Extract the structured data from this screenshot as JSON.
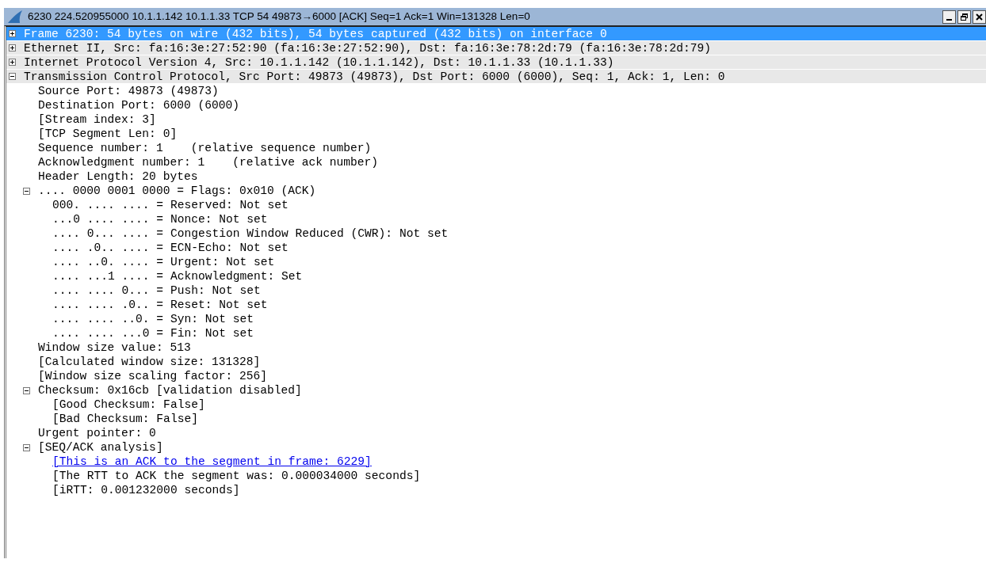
{
  "window": {
    "title": "6230 224.520955000 10.1.1.142 10.1.1.33 TCP 54 49873→6000 [ACK] Seq=1 Ack=1 Win=131328 Len=0"
  },
  "tree": [
    {
      "text": "Frame 6230: 54 bytes on wire (432 bits), 54 bytes captured (432 bits) on interface 0",
      "expanded": false,
      "selected": true
    },
    {
      "text": "Ethernet II, Src: fa:16:3e:27:52:90 (fa:16:3e:27:52:90), Dst: fa:16:3e:78:2d:79 (fa:16:3e:78:2d:79)",
      "expanded": false,
      "selected": false
    },
    {
      "text": "Internet Protocol Version 4, Src: 10.1.1.142 (10.1.1.142), Dst: 10.1.1.33 (10.1.1.33)",
      "expanded": false,
      "selected": false
    },
    {
      "text": "Transmission Control Protocol, Src Port: 49873 (49873), Dst Port: 6000 (6000), Seq: 1, Ack: 1, Len: 0",
      "expanded": true,
      "selected": false,
      "children": [
        {
          "text": "Source Port: 49873 (49873)",
          "selected": false
        },
        {
          "text": "Destination Port: 6000 (6000)",
          "selected": false
        },
        {
          "text": "[Stream index: 3]",
          "selected": false
        },
        {
          "text": "[TCP Segment Len: 0]",
          "selected": false
        },
        {
          "text": "Sequence number: 1    (relative sequence number)",
          "selected": false
        },
        {
          "text": "Acknowledgment number: 1    (relative ack number)",
          "selected": false
        },
        {
          "text": "Header Length: 20 bytes",
          "selected": false
        },
        {
          "text": ".... 0000 0001 0000 = Flags: 0x010 (ACK)",
          "expanded": true,
          "selected": false,
          "children": [
            {
              "text": "000. .... .... = Reserved: Not set",
              "selected": false
            },
            {
              "text": "...0 .... .... = Nonce: Not set",
              "selected": false
            },
            {
              "text": ".... 0... .... = Congestion Window Reduced (CWR): Not set",
              "selected": false
            },
            {
              "text": ".... .0.. .... = ECN-Echo: Not set",
              "selected": false
            },
            {
              "text": ".... ..0. .... = Urgent: Not set",
              "selected": false
            },
            {
              "text": ".... ...1 .... = Acknowledgment: Set",
              "selected": false
            },
            {
              "text": ".... .... 0... = Push: Not set",
              "selected": false
            },
            {
              "text": ".... .... .0.. = Reset: Not set",
              "selected": false
            },
            {
              "text": ".... .... ..0. = Syn: Not set",
              "selected": false
            },
            {
              "text": ".... .... ...0 = Fin: Not set",
              "selected": false
            }
          ]
        },
        {
          "text": "Window size value: 513",
          "selected": false
        },
        {
          "text": "[Calculated window size: 131328]",
          "selected": false
        },
        {
          "text": "[Window size scaling factor: 256]",
          "selected": false
        },
        {
          "text": "Checksum: 0x16cb [validation disabled]",
          "expanded": true,
          "selected": false,
          "children": [
            {
              "text": "[Good Checksum: False]",
              "selected": false
            },
            {
              "text": "[Bad Checksum: False]",
              "selected": false
            }
          ]
        },
        {
          "text": "Urgent pointer: 0",
          "selected": false
        },
        {
          "text": "[SEQ/ACK analysis]",
          "expanded": true,
          "selected": false,
          "children": [
            {
              "kind": "link",
              "text": "[This is an ACK to the segment in frame: 6229]",
              "selected": false
            },
            {
              "text": "[The RTT to ACK the segment was: 0.000034000 seconds]",
              "selected": false
            },
            {
              "text": "[iRTT: 0.001232000 seconds]",
              "selected": false
            }
          ]
        }
      ]
    }
  ]
}
